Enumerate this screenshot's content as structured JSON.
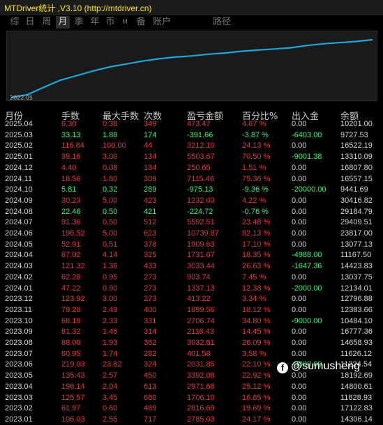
{
  "window": {
    "title": "MTDriver统计 ,V3.10 (http://mtdriver.cn)"
  },
  "tabs": [
    {
      "label": "综",
      "active": false
    },
    {
      "label": "日",
      "active": false
    },
    {
      "label": "周",
      "active": false
    },
    {
      "label": "月",
      "active": true
    },
    {
      "label": "季",
      "active": false
    },
    {
      "label": "年",
      "active": false
    },
    {
      "label": "币",
      "active": false
    },
    {
      "label": "M",
      "active": false
    },
    {
      "label": "备",
      "active": false
    },
    {
      "label": "账户",
      "active": false
    },
    {
      "label": "路径",
      "active": false
    }
  ],
  "chart": {
    "start_label": "2022.05",
    "line_color": "#1ea7d9"
  },
  "chart_data": {
    "type": "line",
    "x_start": "2022.05",
    "trend": [
      0.0,
      0.05,
      0.18,
      0.3,
      0.38,
      0.46,
      0.53,
      0.58,
      0.63,
      0.67,
      0.7,
      0.72,
      0.75,
      0.77,
      0.8,
      0.82,
      0.84,
      0.86,
      0.9,
      0.93,
      0.95,
      0.97,
      1.0
    ]
  },
  "columns": [
    "月份",
    "手数",
    "最大手数",
    "次数",
    "盈亏金额",
    "百分比%",
    "出入金",
    "余额"
  ],
  "rows": [
    {
      "month": "2025.04",
      "lots": "6.30",
      "max": "0.38",
      "count": "349",
      "pnl": "473.47",
      "pct": "4.67 %",
      "flow": "0.00",
      "balance": "10201.00",
      "color": "neg"
    },
    {
      "month": "2025.03",
      "lots": "33.13",
      "max": "1.88",
      "count": "174",
      "pnl": "-391.66",
      "pct": "-3.87 %",
      "flow": "-6403.00",
      "balance": "9727.53",
      "color": "pos"
    },
    {
      "month": "2025.02",
      "lots": "116.84",
      "max": "100.00",
      "count": "44",
      "pnl": "3212.10",
      "pct": "24.13 %",
      "flow": "0.00",
      "balance": "16522.19",
      "color": "neg"
    },
    {
      "month": "2025.01",
      "lots": "39.16",
      "max": "3.00",
      "count": "134",
      "pnl": "5503.67",
      "pct": "70.50 %",
      "flow": "-9001.38",
      "balance": "13310.09",
      "color": "neg"
    },
    {
      "month": "2024.12",
      "lots": "4.40",
      "max": "0.08",
      "count": "184",
      "pnl": "250.65",
      "pct": "1.51 %",
      "flow": "0.00",
      "balance": "16807.80",
      "color": "neg"
    },
    {
      "month": "2024.11",
      "lots": "18.56",
      "max": "1.80",
      "count": "309",
      "pnl": "7115.46",
      "pct": "75.36 %",
      "flow": "0.00",
      "balance": "16557.15",
      "color": "neg"
    },
    {
      "month": "2024.10",
      "lots": "5.81",
      "max": "0.32",
      "count": "289",
      "pnl": "-975.13",
      "pct": "-9.36 %",
      "flow": "-20000.00",
      "balance": "9441.69",
      "color": "pos"
    },
    {
      "month": "2024.09",
      "lots": "30.23",
      "max": "5.00",
      "count": "423",
      "pnl": "1232.03",
      "pct": "4.22 %",
      "flow": "0.00",
      "balance": "30416.82",
      "color": "neg"
    },
    {
      "month": "2024.08",
      "lots": "22.46",
      "max": "0.50",
      "count": "421",
      "pnl": "-224.72",
      "pct": "-0.76 %",
      "flow": "0.00",
      "balance": "29184.79",
      "color": "pos"
    },
    {
      "month": "2024.07",
      "lots": "91.36",
      "max": "0.50",
      "count": "512",
      "pnl": "5592.51",
      "pct": "23.48 %",
      "flow": "0.00",
      "balance": "29409.51",
      "color": "neg"
    },
    {
      "month": "2024.06",
      "lots": "196.52",
      "max": "5.00",
      "count": "623",
      "pnl": "10739.87",
      "pct": "82.13 %",
      "flow": "0.00",
      "balance": "23817.00",
      "color": "neg"
    },
    {
      "month": "2024.05",
      "lots": "52.91",
      "max": "0.51",
      "count": "378",
      "pnl": "1909.63",
      "pct": "17.10 %",
      "flow": "0.00",
      "balance": "13077.13",
      "color": "neg"
    },
    {
      "month": "2024.04",
      "lots": "87.02",
      "max": "4.14",
      "count": "325",
      "pnl": "1731.67",
      "pct": "18.35 %",
      "flow": "-4988.00",
      "balance": "11167.50",
      "color": "neg"
    },
    {
      "month": "2024.03",
      "lots": "121.32",
      "max": "1.36",
      "count": "433",
      "pnl": "3033.44",
      "pct": "26.63 %",
      "flow": "-1647.36",
      "balance": "14423.83",
      "color": "neg"
    },
    {
      "month": "2024.02",
      "lots": "62.28",
      "max": "0.95",
      "count": "273",
      "pnl": "903.74",
      "pct": "7.45 %",
      "flow": "0.00",
      "balance": "13037.75",
      "color": "neg"
    },
    {
      "month": "2024.01",
      "lots": "47.22",
      "max": "0.90",
      "count": "273",
      "pnl": "1337.13",
      "pct": "12.38 %",
      "flow": "-2000.00",
      "balance": "12134.01",
      "color": "neg"
    },
    {
      "month": "2023.12",
      "lots": "123.92",
      "max": "3.00",
      "count": "273",
      "pnl": "413.22",
      "pct": "3.34 %",
      "flow": "0.00",
      "balance": "12796.88",
      "color": "neg"
    },
    {
      "month": "2023.11",
      "lots": "79.28",
      "max": "2.49",
      "count": "400",
      "pnl": "1899.56",
      "pct": "18.12 %",
      "flow": "0.00",
      "balance": "12383.66",
      "color": "neg"
    },
    {
      "month": "2023.10",
      "lots": "68.18",
      "max": "2.33",
      "count": "331",
      "pnl": "2706.74",
      "pct": "34.80 %",
      "flow": "-9000.00",
      "balance": "10484.10",
      "color": "neg"
    },
    {
      "month": "2023.09",
      "lots": "81.32",
      "max": "1.46",
      "count": "314",
      "pnl": "2118.43",
      "pct": "14.45 %",
      "flow": "0.00",
      "balance": "16777.36",
      "color": "neg"
    },
    {
      "month": "2023.08",
      "lots": "88.00",
      "max": "1.93",
      "count": "362",
      "pnl": "3032.61",
      "pct": "26.09 %",
      "flow": "0.00",
      "balance": "14658.93",
      "color": "neg"
    },
    {
      "month": "2023.07",
      "lots": "60.95",
      "max": "1.74",
      "count": "282",
      "pnl": "401.58",
      "pct": "3.58 %",
      "flow": "0.00",
      "balance": "11626.12",
      "color": "neg"
    },
    {
      "month": "2023.06",
      "lots": "219.03",
      "max": "23.82",
      "count": "324",
      "pnl": "2031.85",
      "pct": "22.10 %",
      "flow": "-9000.00",
      "balance": "11224.54",
      "color": "neg"
    },
    {
      "month": "2023.05",
      "lots": "135.43",
      "max": "2.57",
      "count": "450",
      "pnl": "3392.08",
      "pct": "22.92 %",
      "flow": "0.00",
      "balance": "18192.69",
      "color": "neg"
    },
    {
      "month": "2023.04",
      "lots": "196.14",
      "max": "2.04",
      "count": "613",
      "pnl": "2971.68",
      "pct": "25.12 %",
      "flow": "0.00",
      "balance": "14800.61",
      "color": "neg"
    },
    {
      "month": "2023.03",
      "lots": "125.57",
      "max": "3.45",
      "count": "680",
      "pnl": "1706.10",
      "pct": "16.85 %",
      "flow": "0.00",
      "balance": "11828.93",
      "color": "neg"
    },
    {
      "month": "2023.02",
      "lots": "61.97",
      "max": "0.60",
      "count": "489",
      "pnl": "2816.69",
      "pct": "19.69 %",
      "flow": "0.00",
      "balance": "17122.83",
      "color": "neg"
    },
    {
      "month": "2023.01",
      "lots": "106.03",
      "max": "2.55",
      "count": "717",
      "pnl": "2785.03",
      "pct": "24.17 %",
      "flow": "0.00",
      "balance": "14306.14",
      "color": "neg"
    }
  ],
  "watermark": {
    "icon": "facebook-icon",
    "text": "@sumusheng"
  }
}
